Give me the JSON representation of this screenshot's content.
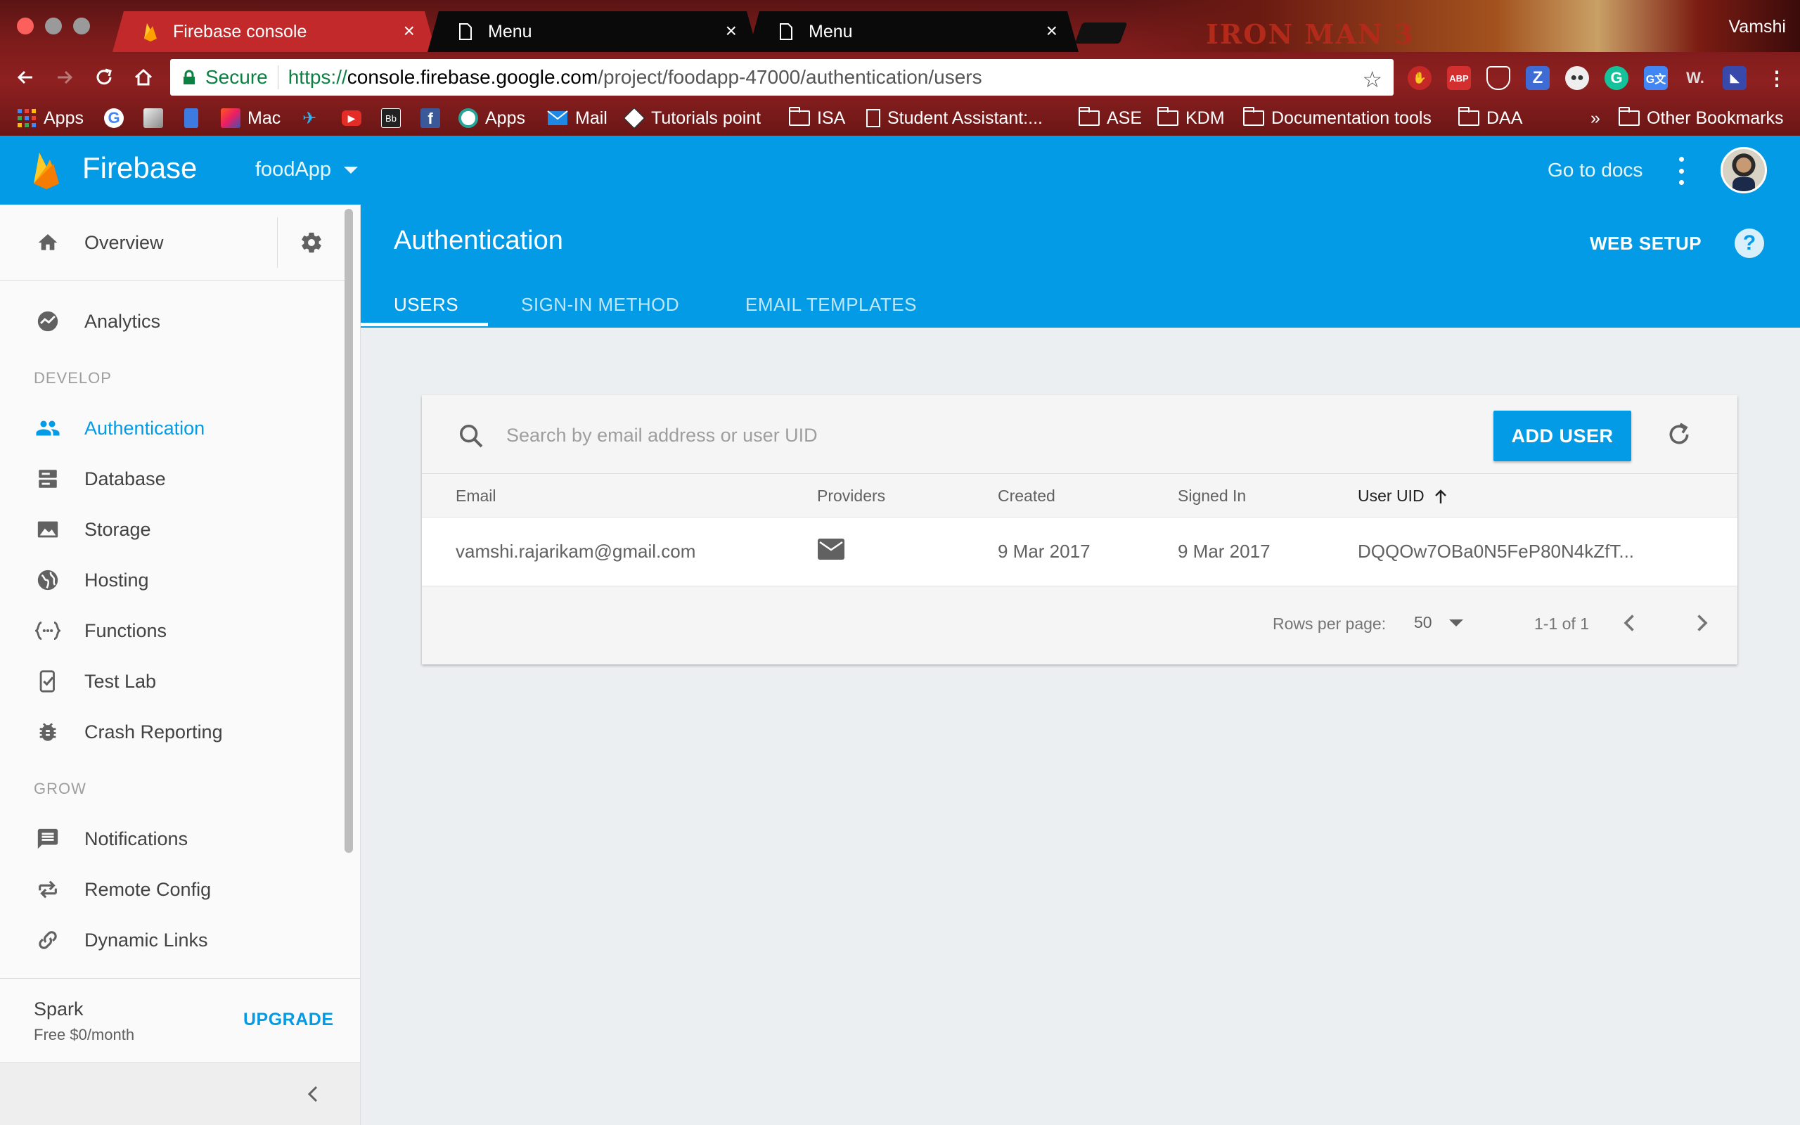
{
  "browser": {
    "tabs": [
      {
        "title": "Firebase console",
        "icon": "firebase-icon",
        "active": true
      },
      {
        "title": "Menu",
        "icon": "page-icon",
        "active": false
      },
      {
        "title": "Menu",
        "icon": "page-icon",
        "active": false
      }
    ],
    "banner_text": "IRON MAN 3",
    "profile_name": "Vamshi",
    "omnibox": {
      "secure_label": "Secure",
      "url_scheme": "https://",
      "url_host": "console.firebase.google.com",
      "url_path": "/project/foodapp-47000/authentication/users"
    },
    "bookmarks": [
      {
        "label": "Apps",
        "icon": "apps-grid-icon"
      },
      {
        "label": "",
        "icon": "google-icon"
      },
      {
        "label": "",
        "icon": "bookmark-image-icon"
      },
      {
        "label": "",
        "icon": "bookmark-blue-icon"
      },
      {
        "label": "Mac",
        "icon": "office-icon"
      },
      {
        "label": "",
        "icon": "bird-icon"
      },
      {
        "label": "",
        "icon": "youtube-icon"
      },
      {
        "label": "",
        "icon": "blackboard-icon"
      },
      {
        "label": "",
        "icon": "facebook-icon"
      },
      {
        "label": "Apps",
        "icon": "apps-swirl-icon"
      },
      {
        "label": "Mail",
        "icon": "mail-icon"
      },
      {
        "label": "Tutorials point",
        "icon": "tutorialspoint-icon"
      },
      {
        "label": "ISA",
        "icon": "folder-icon"
      },
      {
        "label": "Student Assistant:...",
        "icon": "document-icon"
      },
      {
        "label": "ASE",
        "icon": "folder-icon"
      },
      {
        "label": "KDM",
        "icon": "folder-icon"
      },
      {
        "label": "Documentation tools",
        "icon": "folder-icon"
      },
      {
        "label": "DAA",
        "icon": "folder-icon"
      }
    ],
    "overflow_chevron": "»",
    "other_bookmarks": "Other Bookmarks"
  },
  "header": {
    "brand": "Firebase",
    "project": "foodApp",
    "docs_link": "Go to docs"
  },
  "sidebar": {
    "overview": "Overview",
    "analytics": "Analytics",
    "develop_section": "DEVELOP",
    "develop_items": [
      {
        "label": "Authentication",
        "icon": "people-icon",
        "active": true
      },
      {
        "label": "Database",
        "icon": "database-icon"
      },
      {
        "label": "Storage",
        "icon": "image-icon"
      },
      {
        "label": "Hosting",
        "icon": "globe-icon"
      },
      {
        "label": "Functions",
        "icon": "functions-icon"
      },
      {
        "label": "Test Lab",
        "icon": "test-lab-icon"
      },
      {
        "label": "Crash Reporting",
        "icon": "bug-icon"
      }
    ],
    "grow_section": "GROW",
    "grow_items": [
      {
        "label": "Notifications",
        "icon": "message-icon"
      },
      {
        "label": "Remote Config",
        "icon": "remote-config-icon"
      },
      {
        "label": "Dynamic Links",
        "icon": "link-icon"
      }
    ],
    "plan": {
      "name": "Spark",
      "price": "Free $0/month",
      "upgrade": "UPGRADE"
    }
  },
  "main": {
    "title": "Authentication",
    "web_setup": "WEB SETUP",
    "help": "?",
    "tabs": [
      {
        "label": "USERS",
        "active": true
      },
      {
        "label": "SIGN-IN METHOD"
      },
      {
        "label": "EMAIL TEMPLATES"
      }
    ],
    "search_placeholder": "Search by email address or user UID",
    "add_user": "ADD USER",
    "columns": [
      "Email",
      "Providers",
      "Created",
      "Signed In",
      "User UID"
    ],
    "sort_column": "User UID",
    "sort_direction": "ascending",
    "rows": [
      {
        "email": "vamshi.rajarikam@gmail.com",
        "provider_icon": "email-envelope-icon",
        "created": "9 Mar 2017",
        "signed_in": "9 Mar 2017",
        "uid": "DQQOw7OBa0N5FeP80N4kZfT..."
      }
    ],
    "pagination": {
      "rows_per_page_label": "Rows per page:",
      "rows_per_page": "50",
      "range": "1-1 of 1"
    }
  },
  "colors": {
    "firebase_blue": "#039be5",
    "active_tab": "#c1292b",
    "sidebar_bg": "#fafafa",
    "content_bg": "#eceff1"
  }
}
